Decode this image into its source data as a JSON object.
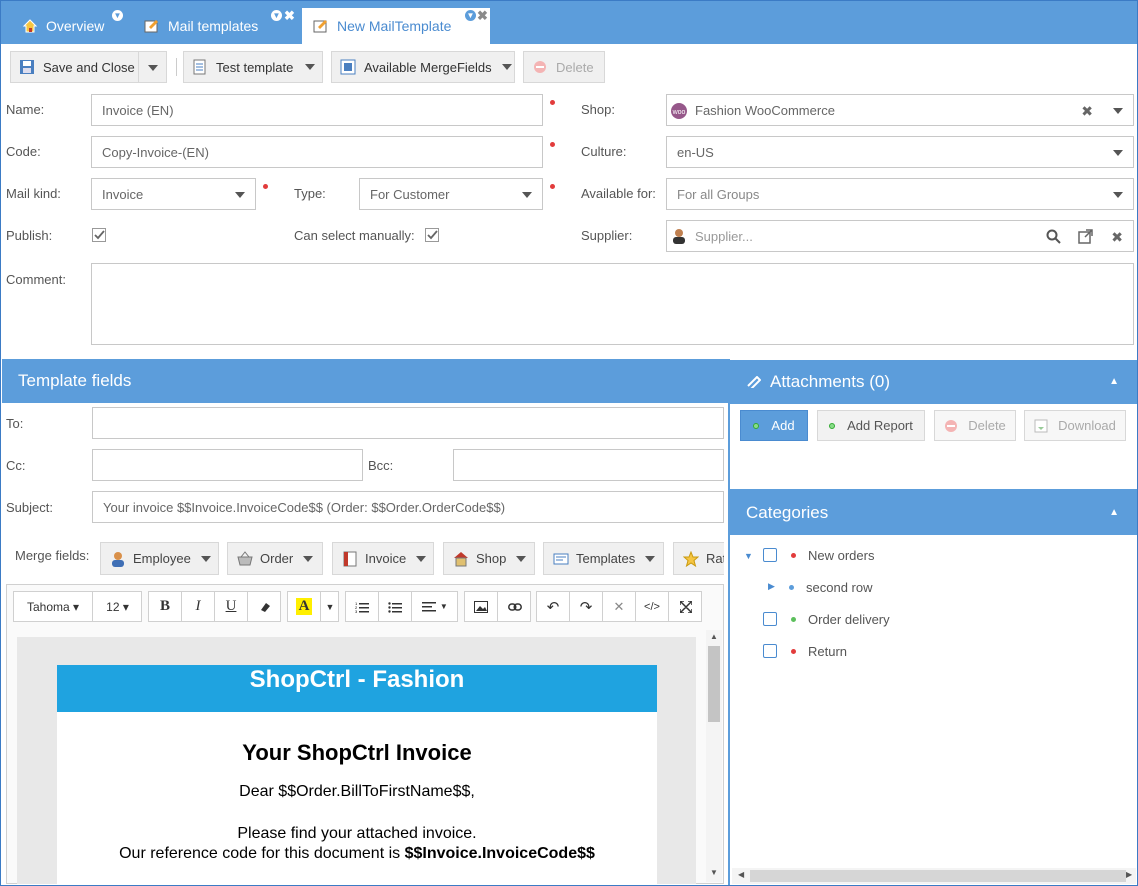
{
  "tabs": [
    {
      "label": "Overview",
      "icon": "home-icon"
    },
    {
      "label": "Mail templates",
      "icon": "mail-template-icon"
    },
    {
      "label": "New MailTemplate",
      "icon": "mail-template-icon",
      "active": true
    }
  ],
  "toolbar": {
    "save_close": "Save and Close",
    "test_template": "Test template",
    "available_mergefields": "Available MergeFields",
    "delete": "Delete"
  },
  "form": {
    "name_label": "Name:",
    "name_value": "Invoice (EN)",
    "code_label": "Code:",
    "code_value": "Copy-Invoice-(EN)",
    "mailkind_label": "Mail kind:",
    "mailkind_value": "Invoice",
    "type_label": "Type:",
    "type_value": "For Customer",
    "publish_label": "Publish:",
    "can_select_label": "Can select manually:",
    "comment_label": "Comment:",
    "shop_label": "Shop:",
    "shop_value": "Fashion WooCommerce",
    "culture_label": "Culture:",
    "culture_value": "en-US",
    "available_for_label": "Available for:",
    "available_for_value": "For all Groups",
    "supplier_label": "Supplier:",
    "supplier_placeholder": "Supplier..."
  },
  "template_fields": {
    "title": "Template fields",
    "to_label": "To:",
    "cc_label": "Cc:",
    "bcc_label": "Bcc:",
    "subject_label": "Subject:",
    "subject_value": "Your invoice $$Invoice.InvoiceCode$$ (Order: $$Order.OrderCode$$)",
    "merge_label": "Merge fields:",
    "merge_buttons": [
      "Employee",
      "Order",
      "Invoice",
      "Shop",
      "Templates",
      "Rat"
    ]
  },
  "editor": {
    "font": "Tahoma",
    "size": "12",
    "banner": "ShopCtrl - Fashion",
    "heading": "Your ShopCtrl Invoice",
    "line1": "Dear $$Order.BillToFirstName$$,",
    "line2": "Please find your attached invoice.",
    "line3_prefix": "Our reference code for this document is ",
    "line3_code": "$$Invoice.InvoiceCode$$"
  },
  "attachments": {
    "title": "Attachments (0)",
    "add": "Add",
    "add_report": "Add Report",
    "delete": "Delete",
    "download": "Download"
  },
  "categories": {
    "title": "Categories",
    "items": [
      "New orders",
      "second row",
      "Order delivery",
      "Return"
    ]
  },
  "colors": {
    "accent": "#5c9ddb",
    "required": "#e23b3b",
    "banner": "#1fa3e0"
  }
}
